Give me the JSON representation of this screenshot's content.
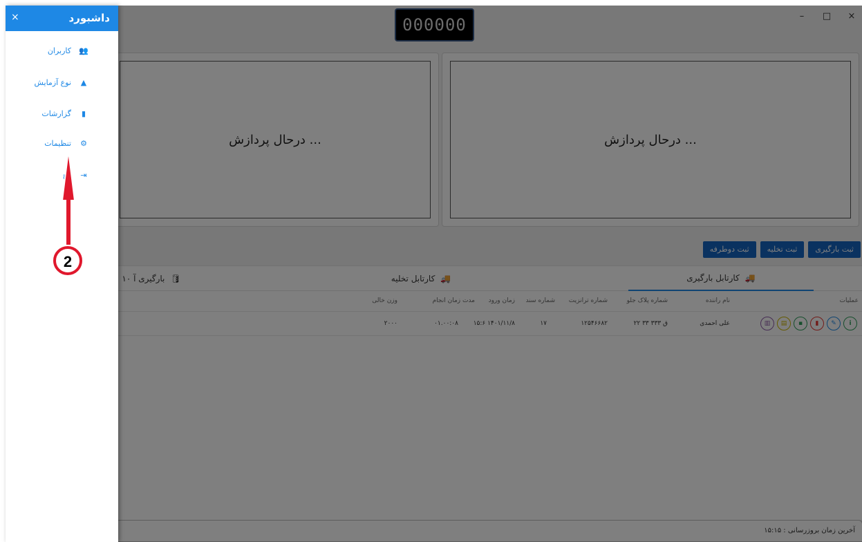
{
  "window": {
    "counter": "000000",
    "controls": [
      "–",
      "□",
      "×"
    ]
  },
  "panels": {
    "left_status": "درحال پردازش ...",
    "right_status": "درحال پردازش ..."
  },
  "actions": {
    "loading": "ثبت بارگیری",
    "unloading": "ثبت تخلیه",
    "two_way": "ثبت دوطرفه"
  },
  "tabs": [
    {
      "label": "کارتابل بارگیری",
      "icon": "truck-icon"
    },
    {
      "label": "کارتابل تخلیه",
      "icon": "truck-icon"
    },
    {
      "label": "۱۰ بارگیری آ",
      "icon": "database-icon"
    }
  ],
  "table": {
    "headers": [
      "عملیات",
      "نام راننده",
      "شماره پلاک جلو",
      "شماره ترانزیت",
      "شماره سند",
      "زمان ورود",
      "مدت زمان انجام",
      "وزن خالی"
    ],
    "row": {
      "driver": "علی احمدی",
      "plate": "۲۲ ق ۳۳۳ ۳۳",
      "transit": "۱۲۵۴۶۶۸۲",
      "document": "۱۷",
      "entry_time": "۱۵:۶ ۱۴۰۱/۱۱/۸",
      "duration": "۰۱.۰۰:۰۸",
      "empty_weight": "۲۰۰۰"
    }
  },
  "status": {
    "last_update": "آخرین زمان بروزرسانی : ۱۵:۱۵"
  },
  "drawer": {
    "title": "داشبورد",
    "close": "×",
    "items": [
      {
        "label": "کاربران",
        "icon": "users-icon"
      },
      {
        "label": "نوع آزمایش",
        "icon": "flask-icon"
      },
      {
        "label": "گزارشات",
        "icon": "file-icon"
      },
      {
        "label": "تنظیمات",
        "icon": "gear-icon"
      },
      {
        "label": "وج",
        "icon": "exit-icon"
      }
    ]
  },
  "annotation": {
    "step": "2",
    "color": "#e0182d"
  },
  "colors": {
    "accent": "#1e88e5",
    "button": "#1565c0"
  }
}
